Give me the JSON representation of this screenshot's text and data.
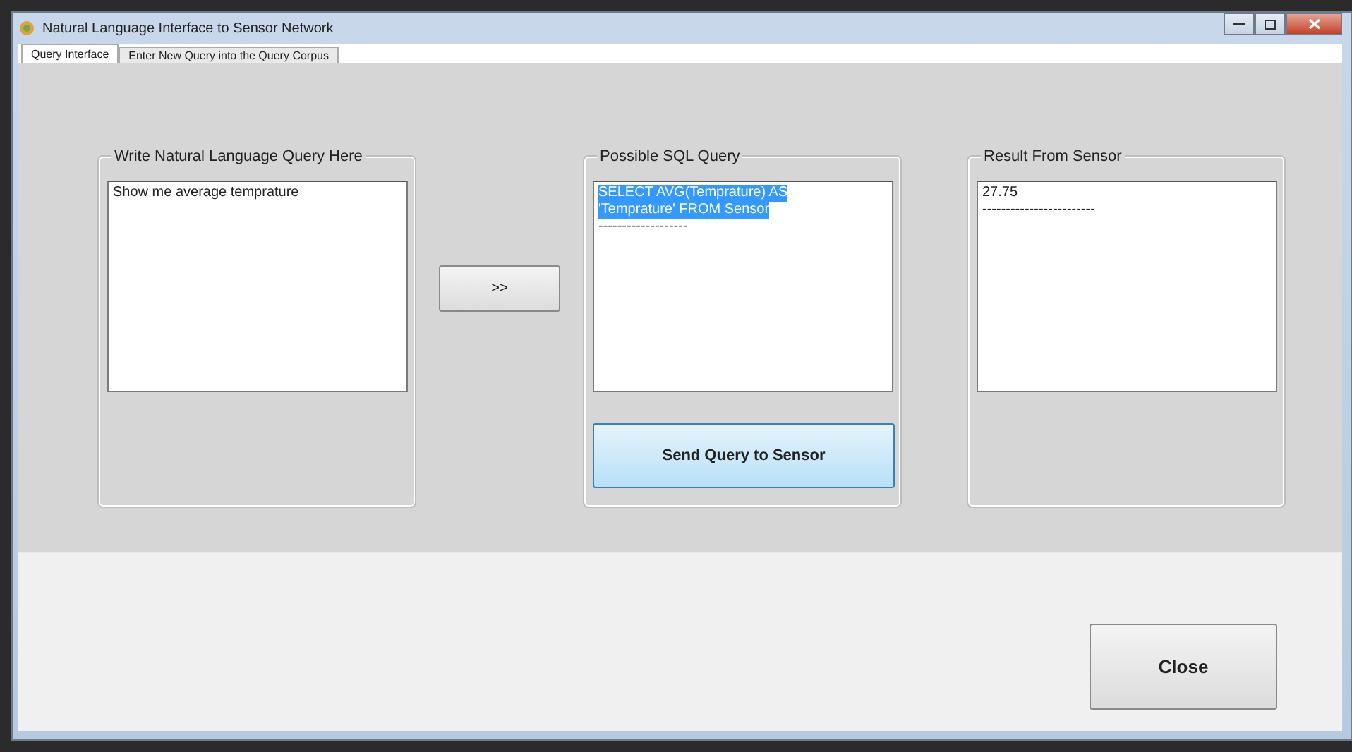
{
  "window": {
    "title": "Natural Language Interface to Sensor Network"
  },
  "tabs": [
    {
      "label": "Query Interface",
      "selected": true
    },
    {
      "label": "Enter New Query into the Query Corpus",
      "selected": false
    }
  ],
  "query_panel": {
    "title": "Write Natural Language Query Here",
    "lines": [
      {
        "text": "Show me average temprature",
        "selected": false
      }
    ]
  },
  "convert_button": ">>",
  "sql_panel": {
    "title": "Possible SQL Query",
    "lines": [
      {
        "text": "SELECT AVG(Temprature) AS",
        "selected": true
      },
      {
        "text": "'Temprature' FROM Sensor",
        "selected": true
      },
      {
        "text": "-------------------",
        "selected": false
      }
    ],
    "send_button": "Send Query to Sensor"
  },
  "result_panel": {
    "title": "Result From Sensor",
    "lines": [
      {
        "text": "27.75",
        "selected": false
      },
      {
        "text": "------------------------",
        "selected": false
      }
    ]
  },
  "close_button": "Close"
}
